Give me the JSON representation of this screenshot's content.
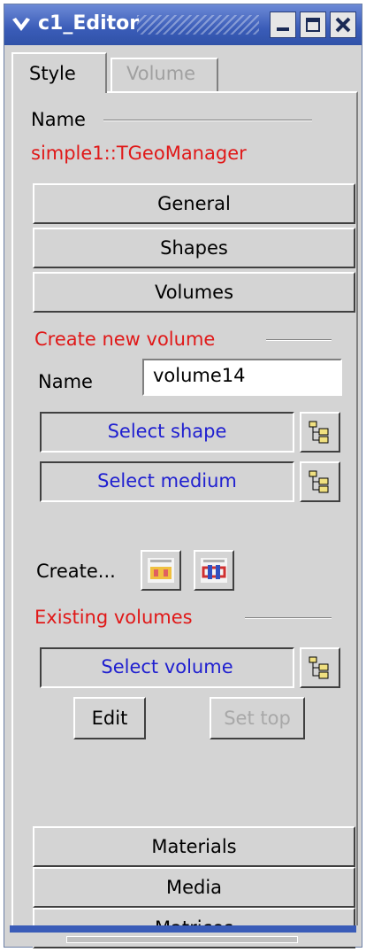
{
  "window": {
    "title": "c1_Editor",
    "accent": "#3a5cb8"
  },
  "tabs": [
    {
      "label": "Style",
      "active": true
    },
    {
      "label": "Volume",
      "active": false
    }
  ],
  "name_section": {
    "label": "Name",
    "value": "simple1::TGeoManager"
  },
  "sections": {
    "general": "General",
    "shapes": "Shapes",
    "volumes": "Volumes",
    "materials": "Materials",
    "media": "Media",
    "matrices": "Matrices"
  },
  "create": {
    "heading": "Create new volume",
    "name_label": "Name",
    "name_value": "volume14",
    "select_shape": "Select shape",
    "select_medium": "Select medium",
    "create_label": "Create..."
  },
  "existing": {
    "heading": "Existing volumes",
    "select_volume": "Select volume",
    "edit_label": "Edit",
    "set_top_label": "Set top"
  },
  "icons": {
    "window_menu": "chevron-down-icon",
    "minimize": "minimize-icon",
    "maximize": "maximize-icon",
    "close": "close-icon",
    "picker": "tree-picker-icon",
    "assembly": "assembly-icon",
    "volume": "volume-icon"
  }
}
